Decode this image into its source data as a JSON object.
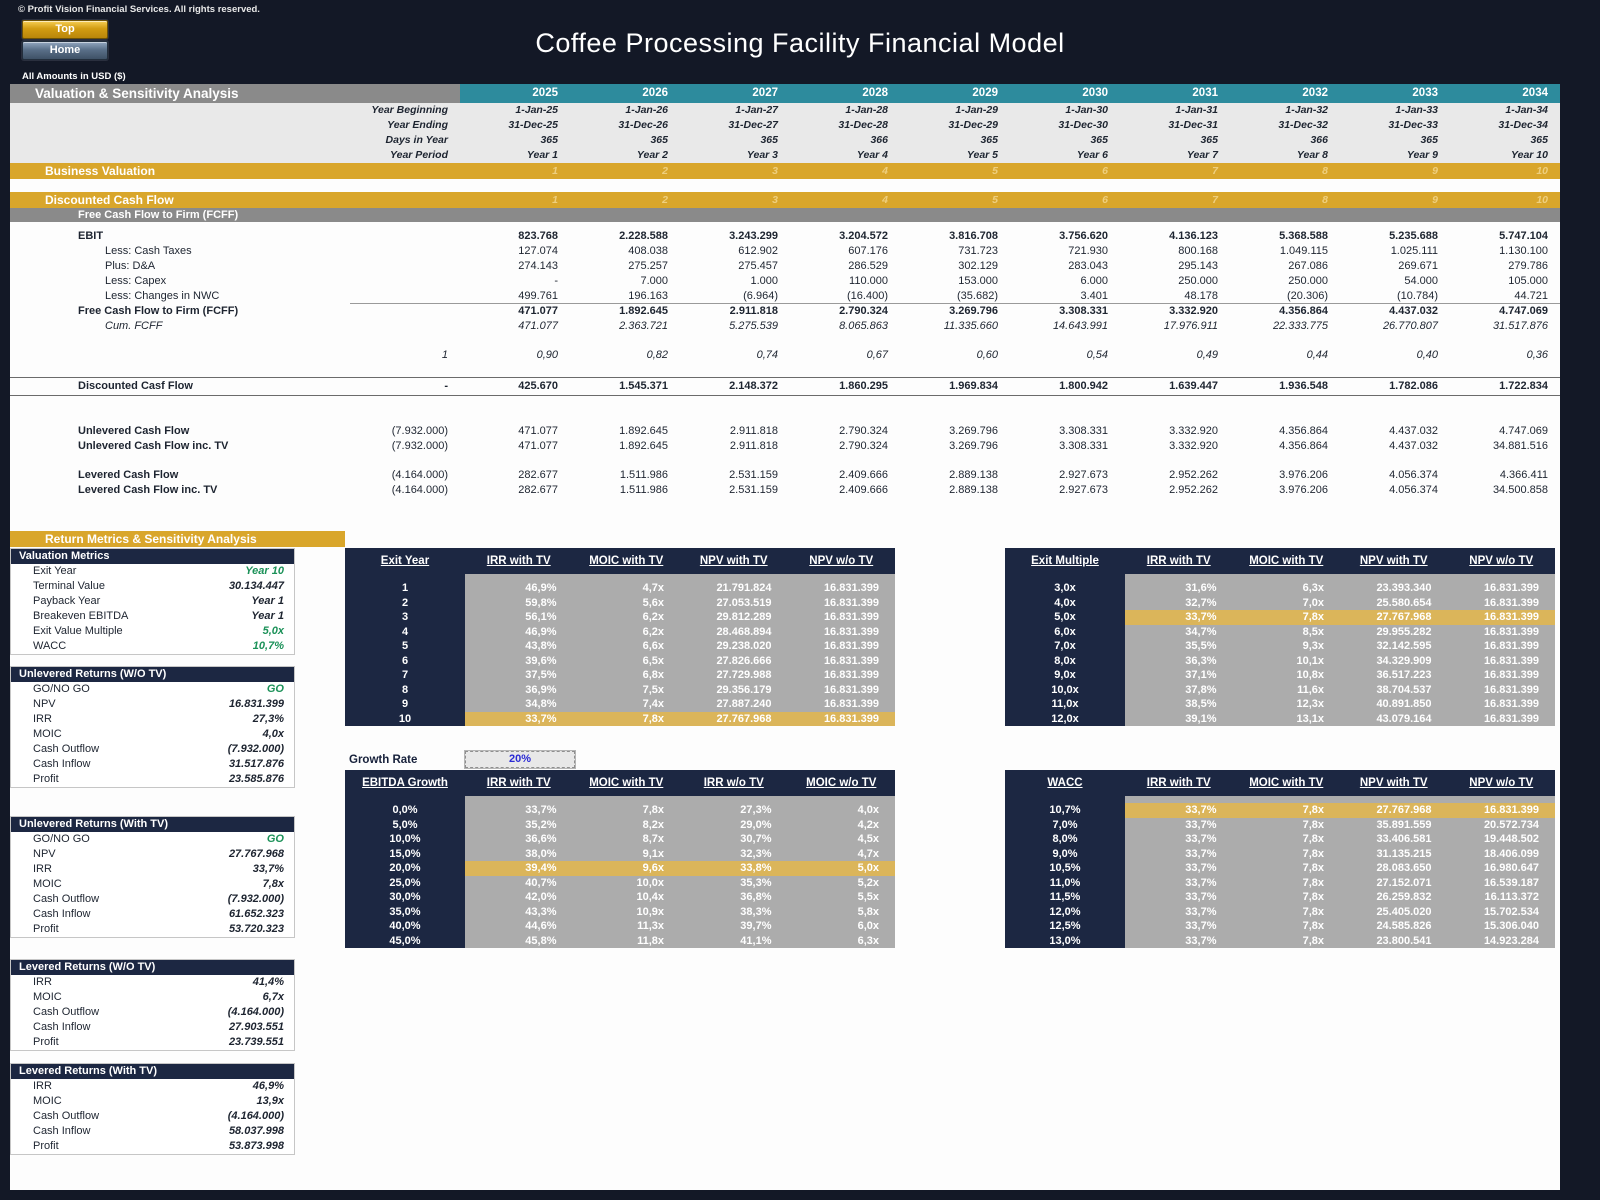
{
  "header": {
    "copyright": "© Profit Vision Financial Services. All rights reserved.",
    "top_button": "Top",
    "home_button": "Home",
    "title": "Coffee Processing Facility Financial Model",
    "amounts_note": "All Amounts in  USD ($)"
  },
  "colors": {
    "page_bg": "#131826",
    "teal": "#2d8b9d",
    "gold_band": "#d9a62b",
    "gray_band": "#8a8a8a",
    "navy_panel": "#1c2742",
    "data_gray": "#acacac",
    "highlight_gold": "#dbb55a",
    "green": "#1b9158",
    "input_blue": "#2a2ad4"
  },
  "sheet": {
    "section_title": "Valuation & Sensitivity Analysis",
    "years": [
      "2025",
      "2026",
      "2027",
      "2028",
      "2029",
      "2030",
      "2031",
      "2032",
      "2033",
      "2034"
    ],
    "date_rows": [
      {
        "label": "Year Beginning",
        "values": [
          "1-Jan-25",
          "1-Jan-26",
          "1-Jan-27",
          "1-Jan-28",
          "1-Jan-29",
          "1-Jan-30",
          "1-Jan-31",
          "1-Jan-32",
          "1-Jan-33",
          "1-Jan-34"
        ]
      },
      {
        "label": "Year Ending",
        "values": [
          "31-Dec-25",
          "31-Dec-26",
          "31-Dec-27",
          "31-Dec-28",
          "31-Dec-29",
          "31-Dec-30",
          "31-Dec-31",
          "31-Dec-32",
          "31-Dec-33",
          "31-Dec-34"
        ]
      },
      {
        "label": "Days in Year",
        "values": [
          "365",
          "365",
          "365",
          "366",
          "365",
          "365",
          "365",
          "366",
          "365",
          "365"
        ]
      },
      {
        "label": "Year Period",
        "values": [
          "Year 1",
          "Year 2",
          "Year 3",
          "Year 4",
          "Year 5",
          "Year 6",
          "Year 7",
          "Year 8",
          "Year 9",
          "Year 10"
        ]
      }
    ],
    "business_valuation_band": {
      "label": "Business Valuation",
      "faint_values": [
        "1",
        "2",
        "3",
        "4",
        "5",
        "6",
        "7",
        "8",
        "9",
        "10"
      ]
    },
    "dcf_band": {
      "label": "Discounted Cash Flow",
      "faint_values": [
        "1",
        "2",
        "3",
        "4",
        "5",
        "6",
        "7",
        "8",
        "9",
        "10"
      ]
    },
    "fcff_band": "Free Cash Flow to Firm (FCFF)",
    "fcff_rows": [
      {
        "label": "EBIT",
        "cls": "b",
        "initial": "",
        "values": [
          "823.768",
          "2.228.588",
          "3.243.299",
          "3.204.572",
          "3.816.708",
          "3.756.620",
          "4.136.123",
          "5.368.588",
          "5.235.688",
          "5.747.104"
        ]
      },
      {
        "label": "Less: Cash Taxes",
        "cls": "ind2",
        "initial": "",
        "values": [
          "127.074",
          "408.038",
          "612.902",
          "607.176",
          "731.723",
          "721.930",
          "800.168",
          "1.049.115",
          "1.025.111",
          "1.130.100"
        ]
      },
      {
        "label": "Plus: D&A",
        "cls": "ind2",
        "initial": "",
        "values": [
          "274.143",
          "275.257",
          "275.457",
          "286.529",
          "302.129",
          "283.043",
          "295.143",
          "267.086",
          "269.671",
          "279.786"
        ]
      },
      {
        "label": "Less: Capex",
        "cls": "ind2",
        "initial": "",
        "values": [
          "-",
          "7.000",
          "1.000",
          "110.000",
          "153.000",
          "6.000",
          "250.000",
          "250.000",
          "54.000",
          "105.000"
        ]
      },
      {
        "label": "Less: Changes in NWC",
        "cls": "ind2 u",
        "initial": "",
        "values": [
          "499.761",
          "196.163",
          "(6.964)",
          "(16.400)",
          "(35.682)",
          "3.401",
          "48.178",
          "(20.306)",
          "(10.784)",
          "44.721"
        ]
      },
      {
        "label": "Free Cash Flow to Firm (FCFF)",
        "cls": "b",
        "initial": "",
        "values": [
          "471.077",
          "1.892.645",
          "2.911.818",
          "2.790.324",
          "3.269.796",
          "3.308.331",
          "3.332.920",
          "4.356.864",
          "4.437.032",
          "4.747.069"
        ]
      },
      {
        "label": "Cum. FCFF",
        "cls": "ind2 it",
        "initial": "",
        "values": [
          "471.077",
          "2.363.721",
          "5.275.539",
          "8.065.863",
          "11.335.660",
          "14.643.991",
          "17.976.911",
          "22.333.775",
          "26.770.807",
          "31.517.876"
        ]
      }
    ],
    "factor_row": {
      "label": "",
      "initial": "1",
      "values": [
        "0,90",
        "0,82",
        "0,74",
        "0,67",
        "0,60",
        "0,54",
        "0,49",
        "0,44",
        "0,40",
        "0,36"
      ]
    },
    "dcf_row": {
      "label": "Discounted Casf Flow",
      "initial": "-",
      "values": [
        "425.670",
        "1.545.371",
        "2.148.372",
        "1.860.295",
        "1.969.834",
        "1.800.942",
        "1.639.447",
        "1.936.548",
        "1.782.086",
        "1.722.834"
      ]
    },
    "cash_flow_rows": [
      {
        "label": "Unlevered Cash Flow",
        "initial": "(7.932.000)",
        "values": [
          "471.077",
          "1.892.645",
          "2.911.818",
          "2.790.324",
          "3.269.796",
          "3.308.331",
          "3.332.920",
          "4.356.864",
          "4.437.032",
          "4.747.069"
        ],
        "gap_before": 0
      },
      {
        "label": "Unlevered Cash Flow inc. TV",
        "initial": "(7.932.000)",
        "values": [
          "471.077",
          "1.892.645",
          "2.911.818",
          "2.790.324",
          "3.269.796",
          "3.308.331",
          "3.332.920",
          "4.356.864",
          "4.437.032",
          "34.881.516"
        ],
        "gap_before": 0
      },
      {
        "label": "Levered Cash Flow",
        "initial": "(4.164.000)",
        "values": [
          "282.677",
          "1.511.986",
          "2.531.159",
          "2.409.666",
          "2.889.138",
          "2.927.673",
          "2.952.262",
          "3.976.206",
          "4.056.374",
          "4.366.411"
        ],
        "gap_before": 14
      },
      {
        "label": "Levered Cash Flow inc. TV",
        "initial": "(4.164.000)",
        "values": [
          "282.677",
          "1.511.986",
          "2.531.159",
          "2.409.666",
          "2.889.138",
          "2.927.673",
          "2.952.262",
          "3.976.206",
          "4.056.374",
          "34.500.858"
        ],
        "gap_before": 0
      }
    ]
  },
  "returns_band": "Return Metrics & Sensitivity Analysis",
  "sidebar": {
    "boxes": [
      {
        "title": "Valuation Metrics",
        "rows": [
          {
            "label": "Exit Year",
            "value": "Year 10",
            "green": true
          },
          {
            "label": "Terminal Value",
            "value": "30.134.447",
            "green": false
          },
          {
            "label": "Payback Year",
            "value": "Year 1",
            "green": false
          },
          {
            "label": "Breakeven EBITDA",
            "value": "Year 1",
            "green": false
          },
          {
            "label": "Exit Value Multiple",
            "value": "5,0x",
            "green": true
          },
          {
            "label": "WACC",
            "value": "10,7%",
            "green": true
          }
        ]
      },
      {
        "title": "Unlevered Returns (W/O TV)",
        "rows": [
          {
            "label": "GO/NO GO",
            "value": "GO",
            "green": true
          },
          {
            "label": "NPV",
            "value": "16.831.399",
            "green": false
          },
          {
            "label": "IRR",
            "value": "27,3%",
            "green": false
          },
          {
            "label": "MOIC",
            "value": "4,0x",
            "green": false
          },
          {
            "label": "Cash Outflow",
            "value": "(7.932.000)",
            "green": false
          },
          {
            "label": "Cash Inflow",
            "value": "31.517.876",
            "green": false
          },
          {
            "label": "Profit",
            "value": "23.585.876",
            "green": false
          }
        ]
      },
      {
        "title": "Unlevered Returns (With TV)",
        "rows": [
          {
            "label": "GO/NO GO",
            "value": "GO",
            "green": true
          },
          {
            "label": "NPV",
            "value": "27.767.968",
            "green": false
          },
          {
            "label": "IRR",
            "value": "33,7%",
            "green": false
          },
          {
            "label": "MOIC",
            "value": "7,8x",
            "green": false
          },
          {
            "label": "Cash Outflow",
            "value": "(7.932.000)",
            "green": false
          },
          {
            "label": "Cash Inflow",
            "value": "61.652.323",
            "green": false
          },
          {
            "label": "Profit",
            "value": "53.720.323",
            "green": false
          }
        ]
      },
      {
        "title": "Levered Returns (W/O TV)",
        "rows": [
          {
            "label": "IRR",
            "value": "41,4%",
            "green": false
          },
          {
            "label": "MOIC",
            "value": "6,7x",
            "green": false
          },
          {
            "label": "Cash Outflow",
            "value": "(4.164.000)",
            "green": false
          },
          {
            "label": "Cash Inflow",
            "value": "27.903.551",
            "green": false
          },
          {
            "label": "Profit",
            "value": "23.739.551",
            "green": false
          }
        ]
      },
      {
        "title": "Levered Returns (With TV)",
        "rows": [
          {
            "label": "IRR",
            "value": "46,9%",
            "green": false
          },
          {
            "label": "MOIC",
            "value": "13,9x",
            "green": false
          },
          {
            "label": "Cash Outflow",
            "value": "(4.164.000)",
            "green": false
          },
          {
            "label": "Cash Inflow",
            "value": "58.037.998",
            "green": false
          },
          {
            "label": "Profit",
            "value": "53.873.998",
            "green": false
          }
        ]
      }
    ]
  },
  "sensitivity": {
    "growth_rate": {
      "label": "Growth Rate",
      "value": "20%"
    },
    "tables": [
      {
        "id": "exit-year",
        "key_header": "Exit Year",
        "col_headers": [
          "IRR with TV",
          "MOIC with TV",
          "NPV with TV",
          "NPV w/o TV"
        ],
        "highlight_index": 9,
        "rows": [
          {
            "key": "1",
            "values": [
              "46,9%",
              "4,7x",
              "21.791.824",
              "16.831.399"
            ]
          },
          {
            "key": "2",
            "values": [
              "59,8%",
              "5,6x",
              "27.053.519",
              "16.831.399"
            ]
          },
          {
            "key": "3",
            "values": [
              "56,1%",
              "6,2x",
              "29.812.289",
              "16.831.399"
            ]
          },
          {
            "key": "4",
            "values": [
              "46,9%",
              "6,2x",
              "28.468.894",
              "16.831.399"
            ]
          },
          {
            "key": "5",
            "values": [
              "43,8%",
              "6,6x",
              "29.238.020",
              "16.831.399"
            ]
          },
          {
            "key": "6",
            "values": [
              "39,6%",
              "6,5x",
              "27.826.666",
              "16.831.399"
            ]
          },
          {
            "key": "7",
            "values": [
              "37,5%",
              "6,8x",
              "27.729.988",
              "16.831.399"
            ]
          },
          {
            "key": "8",
            "values": [
              "36,9%",
              "7,5x",
              "29.356.179",
              "16.831.399"
            ]
          },
          {
            "key": "9",
            "values": [
              "34,8%",
              "7,4x",
              "27.887.240",
              "16.831.399"
            ]
          },
          {
            "key": "10",
            "values": [
              "33,7%",
              "7,8x",
              "27.767.968",
              "16.831.399"
            ]
          }
        ]
      },
      {
        "id": "exit-multiple",
        "key_header": "Exit Multiple",
        "col_headers": [
          "IRR with TV",
          "MOIC with TV",
          "NPV with TV",
          "NPV w/o TV"
        ],
        "highlight_index": 2,
        "rows": [
          {
            "key": "3,0x",
            "values": [
              "31,6%",
              "6,3x",
              "23.393.340",
              "16.831.399"
            ]
          },
          {
            "key": "4,0x",
            "values": [
              "32,7%",
              "7,0x",
              "25.580.654",
              "16.831.399"
            ]
          },
          {
            "key": "5,0x",
            "values": [
              "33,7%",
              "7,8x",
              "27.767.968",
              "16.831.399"
            ]
          },
          {
            "key": "6,0x",
            "values": [
              "34,7%",
              "8,5x",
              "29.955.282",
              "16.831.399"
            ]
          },
          {
            "key": "7,0x",
            "values": [
              "35,5%",
              "9,3x",
              "32.142.595",
              "16.831.399"
            ]
          },
          {
            "key": "8,0x",
            "values": [
              "36,3%",
              "10,1x",
              "34.329.909",
              "16.831.399"
            ]
          },
          {
            "key": "9,0x",
            "values": [
              "37,1%",
              "10,8x",
              "36.517.223",
              "16.831.399"
            ]
          },
          {
            "key": "10,0x",
            "values": [
              "37,8%",
              "11,6x",
              "38.704.537",
              "16.831.399"
            ]
          },
          {
            "key": "11,0x",
            "values": [
              "38,5%",
              "12,3x",
              "40.891.850",
              "16.831.399"
            ]
          },
          {
            "key": "12,0x",
            "values": [
              "39,1%",
              "13,1x",
              "43.079.164",
              "16.831.399"
            ]
          }
        ]
      },
      {
        "id": "ebitda-growth",
        "key_header": "EBITDA Growth",
        "col_headers": [
          "IRR with TV",
          "MOIC with TV",
          "IRR w/o TV",
          "MOIC w/o TV"
        ],
        "highlight_index": 4,
        "rows": [
          {
            "key": "0,0%",
            "values": [
              "33,7%",
              "7,8x",
              "27,3%",
              "4,0x"
            ]
          },
          {
            "key": "5,0%",
            "values": [
              "35,2%",
              "8,2x",
              "29,0%",
              "4,2x"
            ]
          },
          {
            "key": "10,0%",
            "values": [
              "36,6%",
              "8,7x",
              "30,7%",
              "4,5x"
            ]
          },
          {
            "key": "15,0%",
            "values": [
              "38,0%",
              "9,1x",
              "32,3%",
              "4,7x"
            ]
          },
          {
            "key": "20,0%",
            "values": [
              "39,4%",
              "9,6x",
              "33,8%",
              "5,0x"
            ]
          },
          {
            "key": "25,0%",
            "values": [
              "40,7%",
              "10,0x",
              "35,3%",
              "5,2x"
            ]
          },
          {
            "key": "30,0%",
            "values": [
              "42,0%",
              "10,4x",
              "36,8%",
              "5,5x"
            ]
          },
          {
            "key": "35,0%",
            "values": [
              "43,3%",
              "10,9x",
              "38,3%",
              "5,8x"
            ]
          },
          {
            "key": "40,0%",
            "values": [
              "44,6%",
              "11,3x",
              "39,7%",
              "6,0x"
            ]
          },
          {
            "key": "45,0%",
            "values": [
              "45,8%",
              "11,8x",
              "41,1%",
              "6,3x"
            ]
          }
        ]
      },
      {
        "id": "wacc",
        "key_header": "WACC",
        "col_headers": [
          "IRR with TV",
          "MOIC with TV",
          "NPV with TV",
          "NPV w/o TV"
        ],
        "highlight_index": 0,
        "rows": [
          {
            "key": "10,7%",
            "values": [
              "33,7%",
              "7,8x",
              "27.767.968",
              "16.831.399"
            ]
          },
          {
            "key": "7,0%",
            "values": [
              "33,7%",
              "7,8x",
              "35.891.559",
              "20.572.734"
            ]
          },
          {
            "key": "8,0%",
            "values": [
              "33,7%",
              "7,8x",
              "33.406.581",
              "19.448.502"
            ]
          },
          {
            "key": "9,0%",
            "values": [
              "33,7%",
              "7,8x",
              "31.135.215",
              "18.406.099"
            ]
          },
          {
            "key": "10,5%",
            "values": [
              "33,7%",
              "7,8x",
              "28.083.650",
              "16.980.647"
            ]
          },
          {
            "key": "11,0%",
            "values": [
              "33,7%",
              "7,8x",
              "27.152.071",
              "16.539.187"
            ]
          },
          {
            "key": "11,5%",
            "values": [
              "33,7%",
              "7,8x",
              "26.259.832",
              "16.113.372"
            ]
          },
          {
            "key": "12,0%",
            "values": [
              "33,7%",
              "7,8x",
              "25.405.020",
              "15.702.534"
            ]
          },
          {
            "key": "12,5%",
            "values": [
              "33,7%",
              "7,8x",
              "24.585.826",
              "15.306.040"
            ]
          },
          {
            "key": "13,0%",
            "values": [
              "33,7%",
              "7,8x",
              "23.800.541",
              "14.923.284"
            ]
          }
        ]
      }
    ]
  }
}
